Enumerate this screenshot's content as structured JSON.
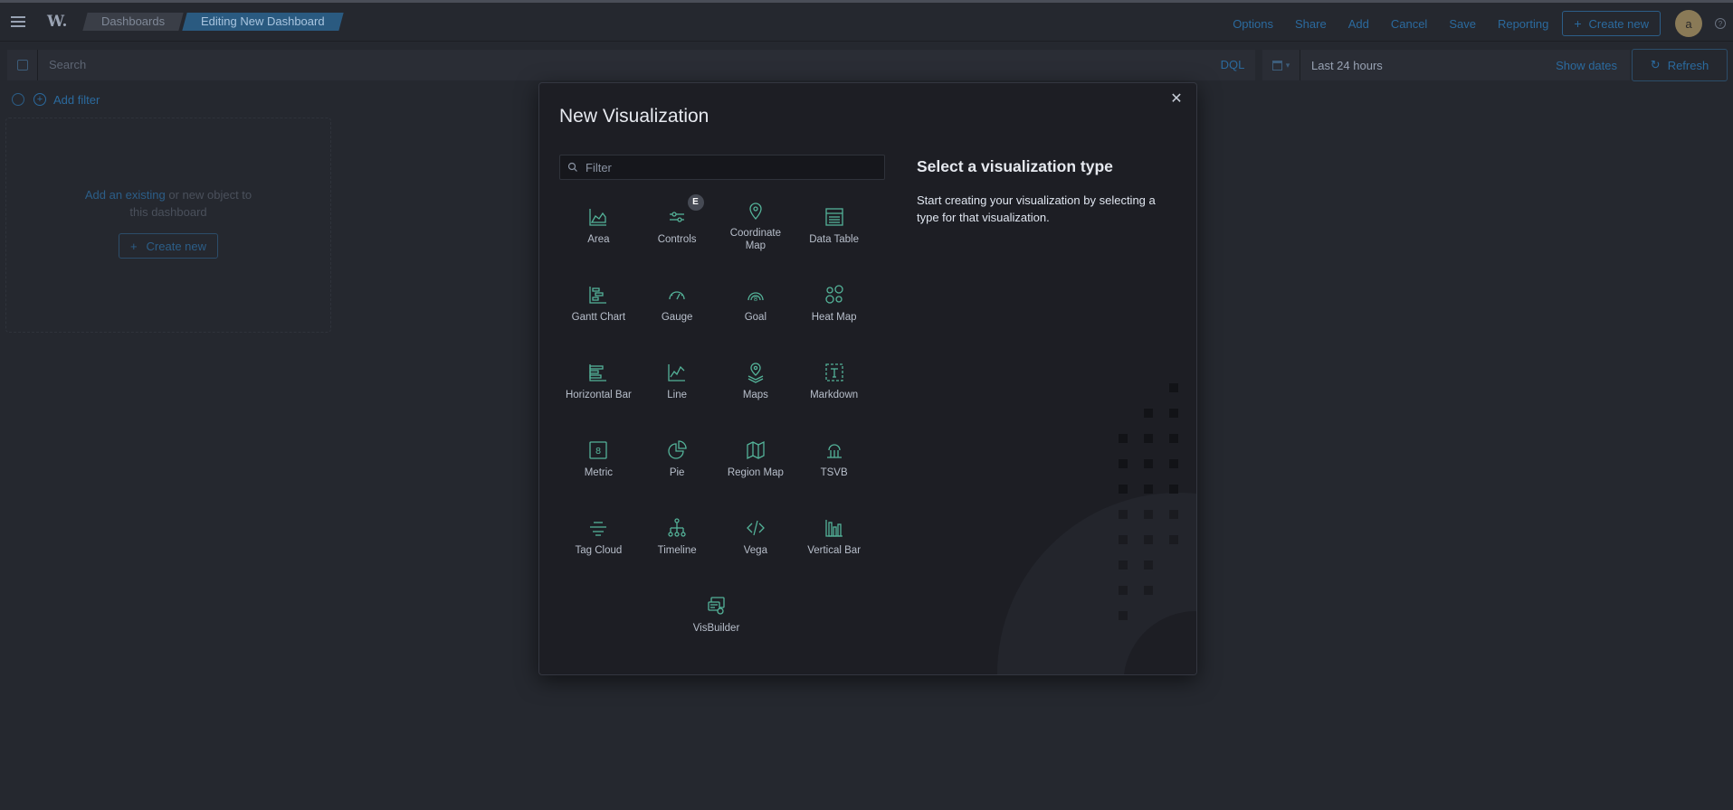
{
  "header": {
    "logo": "W.",
    "breadcrumbs": [
      "Dashboards",
      "Editing New Dashboard"
    ],
    "links": [
      "Options",
      "Share",
      "Add",
      "Cancel",
      "Save",
      "Reporting"
    ],
    "create_new": "Create new",
    "avatar_initial": "a"
  },
  "query": {
    "search_placeholder": "Search",
    "language": "DQL",
    "time_range": "Last 24 hours",
    "show_dates": "Show dates",
    "refresh": "Refresh"
  },
  "filters": {
    "add_filter": "Add filter"
  },
  "empty_panel": {
    "link_text": "Add an existing",
    "rest_text": " or new object to",
    "line2": "this dashboard",
    "create_new": "Create new"
  },
  "modal": {
    "title": "New Visualization",
    "filter_placeholder": "Filter",
    "side_title": "Select a visualization type",
    "side_description": "Start creating your visualization by selecting a type for that visualization.",
    "accent_color": "#54b399",
    "types": [
      {
        "label": "Area",
        "icon": "area-chart-icon"
      },
      {
        "label": "Controls",
        "icon": "controls-icon",
        "badge": "E"
      },
      {
        "label": "Coordinate Map",
        "icon": "map-pin-icon"
      },
      {
        "label": "Data Table",
        "icon": "table-icon"
      },
      {
        "label": "Gantt Chart",
        "icon": "gantt-chart-icon"
      },
      {
        "label": "Gauge",
        "icon": "gauge-icon"
      },
      {
        "label": "Goal",
        "icon": "goal-icon"
      },
      {
        "label": "Heat Map",
        "icon": "heat-map-icon"
      },
      {
        "label": "Horizontal Bar",
        "icon": "horizontal-bar-icon"
      },
      {
        "label": "Line",
        "icon": "line-chart-icon"
      },
      {
        "label": "Maps",
        "icon": "maps-icon"
      },
      {
        "label": "Markdown",
        "icon": "markdown-icon"
      },
      {
        "label": "Metric",
        "icon": "metric-icon"
      },
      {
        "label": "Pie",
        "icon": "pie-chart-icon"
      },
      {
        "label": "Region Map",
        "icon": "region-map-icon"
      },
      {
        "label": "TSVB",
        "icon": "tsvb-icon"
      },
      {
        "label": "Tag Cloud",
        "icon": "tag-cloud-icon"
      },
      {
        "label": "Timeline",
        "icon": "timeline-icon"
      },
      {
        "label": "Vega",
        "icon": "code-icon"
      },
      {
        "label": "Vertical Bar",
        "icon": "vertical-bar-icon"
      },
      {
        "label": "VisBuilder",
        "icon": "visbuilder-icon"
      }
    ]
  }
}
